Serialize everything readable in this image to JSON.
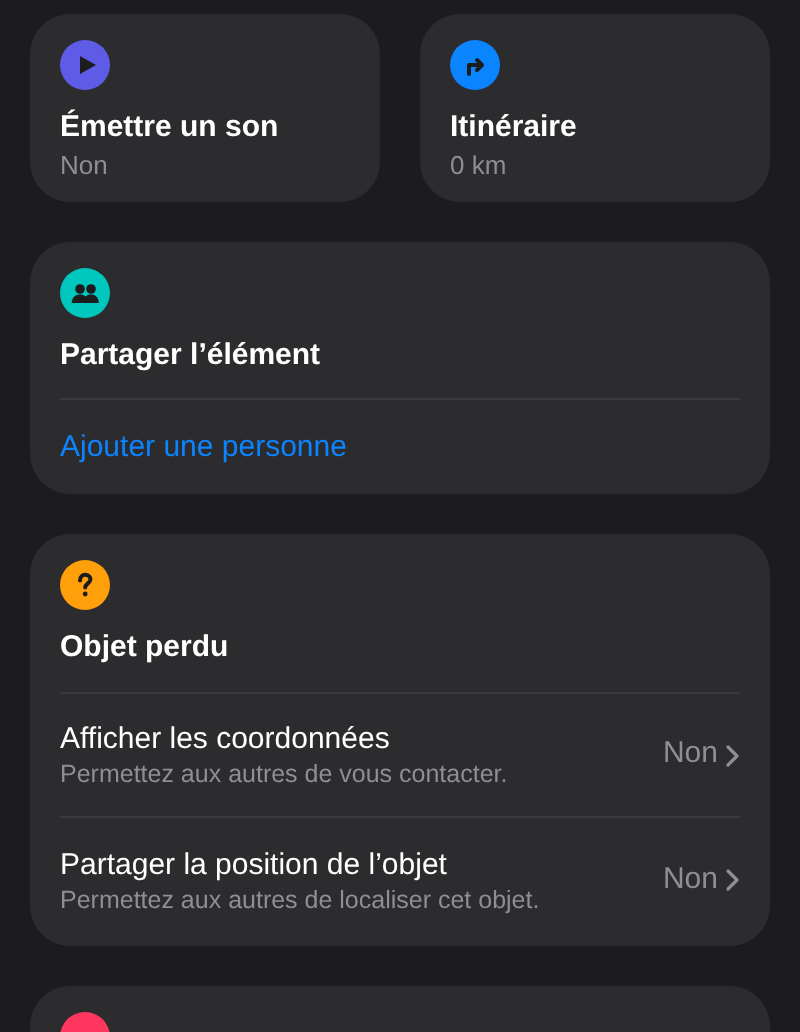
{
  "tiles": [
    {
      "color": "#5e5ce6",
      "title": "Émettre un son",
      "subtitle": "Non"
    },
    {
      "color": "#0a84ff",
      "title": "Itinéraire",
      "subtitle": "0 km"
    }
  ],
  "share": {
    "color": "#00c7be",
    "title": "Partager l’élément",
    "link": "Ajouter une personne"
  },
  "lost": {
    "color": "#ff9f0a",
    "title": "Objet perdu",
    "rows": [
      {
        "title": "Afficher les coordonnées",
        "subtitle": "Permettez aux autres de vous contacter.",
        "value": "Non"
      },
      {
        "title": "Partager la position de l’objet",
        "subtitle": "Permettez aux autres de localiser cet objet.",
        "value": "Non"
      }
    ]
  },
  "next_card": {
    "color": "#ff375f"
  }
}
